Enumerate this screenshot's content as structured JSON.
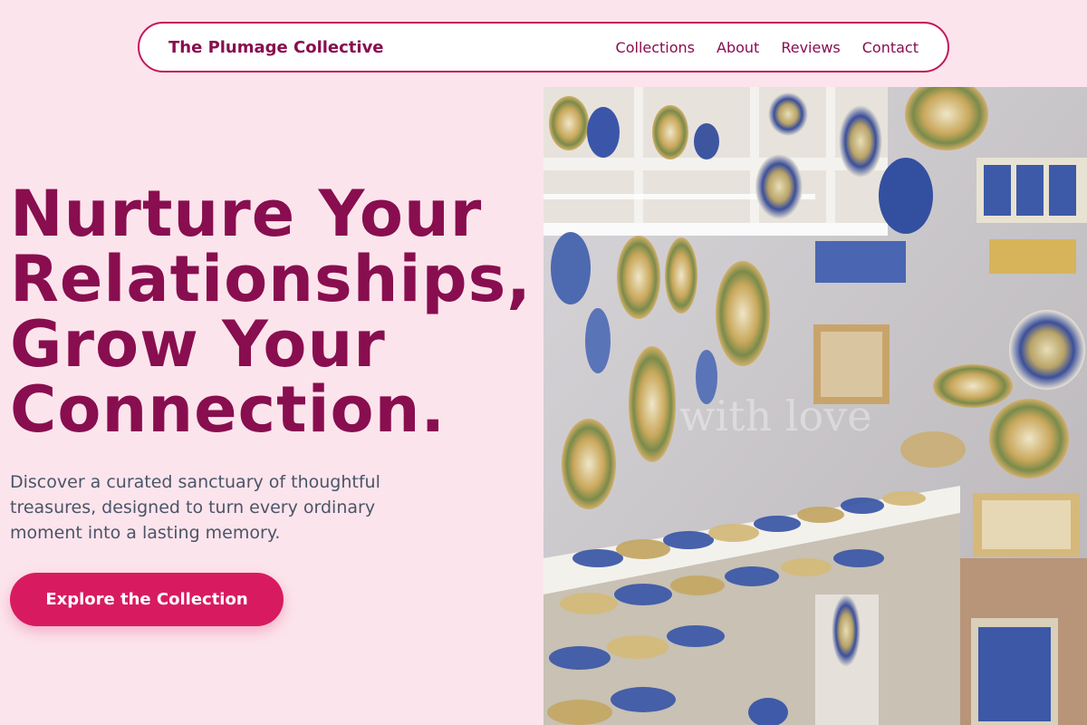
{
  "header": {
    "brand": "The Plumage Collective",
    "nav": [
      "Collections",
      "About",
      "Reviews",
      "Contact"
    ]
  },
  "hero": {
    "headline_lines": [
      "Nurture Your",
      "Relationships,",
      "Grow Your",
      "Connection."
    ],
    "subtext": "Discover a curated sanctuary of thoughtful treasures, designed to turn every ordinary moment into a lasting memory.",
    "cta_label": "Explore the Collection",
    "image_alt": "Shop wall and shelves displaying hand-painted blue and gold ceramic plates, bowls and tiles",
    "watermark_text": "with love"
  },
  "colors": {
    "background": "#fce4ec",
    "primary": "#880e4f",
    "accent": "#d81b60",
    "nav_border": "#c2185b",
    "body_text": "#4a5568"
  }
}
